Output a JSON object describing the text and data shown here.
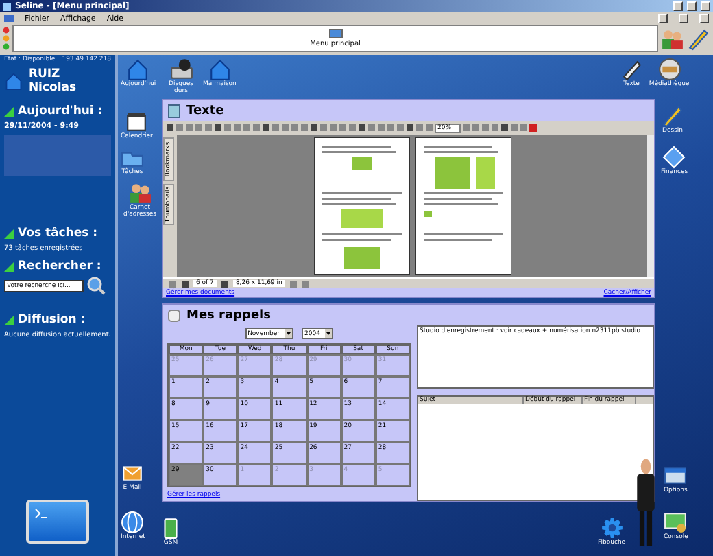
{
  "window": {
    "title": "Seline - [Menu principal]"
  },
  "menu": [
    "Fichier",
    "Affichage",
    "Aide"
  ],
  "toolbar": {
    "center_label": "Menu principal"
  },
  "sidebar": {
    "status": "Etat : Disponible",
    "address": "193.49.142.218",
    "user": "RUIZ Nicolas",
    "sections": [
      {
        "kind": "today",
        "title": "Aujourd'hui :",
        "text": "29/11/2004 - 9:49"
      },
      {
        "kind": "text",
        "title": "Vos tâches :",
        "text": "73 tâches enregistrées"
      },
      {
        "kind": "search",
        "title": "Rechercher :",
        "value": "Votre recherche ici..."
      },
      {
        "kind": "text",
        "title": "Diffusion :",
        "text": "Aucune diffusion actuellement."
      }
    ]
  },
  "desktop_icons": [
    "Aujourd'hui",
    "Disques durs",
    "Ma maison",
    "Calendrier",
    "Tâches",
    "Carnet d'adresses",
    "Texte",
    "Médiathèque",
    "Dessin",
    "Finances",
    "E-Mail",
    "Internet",
    "GSM",
    "Fibouche",
    "Options",
    "Console"
  ],
  "text_window": {
    "title": "Texte",
    "zoom": "20%",
    "side_tabs": [
      "Bookmarks",
      "Thumbnails"
    ],
    "page_indicator": "6 of 7",
    "page_size": "8,26 x 11,69 in",
    "links": [
      "Gérer mes documents",
      "Cacher/Afficher"
    ]
  },
  "reminders": {
    "title": "Mes rappels",
    "month": "November",
    "year": "2004",
    "weekdays": [
      "Mon",
      "Tue",
      "Wed",
      "Thu",
      "Fri",
      "Sat",
      "Sun"
    ],
    "weeks": [
      [
        {
          "day": "25",
          "in_month": false,
          "selected": false
        },
        {
          "day": "26",
          "in_month": false,
          "selected": false
        },
        {
          "day": "27",
          "in_month": false,
          "selected": false
        },
        {
          "day": "28",
          "in_month": false,
          "selected": false
        },
        {
          "day": "29",
          "in_month": false,
          "selected": false
        },
        {
          "day": "30",
          "in_month": false,
          "selected": false
        },
        {
          "day": "31",
          "in_month": false,
          "selected": false
        }
      ],
      [
        {
          "day": "1",
          "in_month": true,
          "selected": false
        },
        {
          "day": "2",
          "in_month": true,
          "selected": false
        },
        {
          "day": "3",
          "in_month": true,
          "selected": false
        },
        {
          "day": "4",
          "in_month": true,
          "selected": false
        },
        {
          "day": "5",
          "in_month": true,
          "selected": false
        },
        {
          "day": "6",
          "in_month": true,
          "selected": false
        },
        {
          "day": "7",
          "in_month": true,
          "selected": false
        }
      ],
      [
        {
          "day": "8",
          "in_month": true,
          "selected": false
        },
        {
          "day": "9",
          "in_month": true,
          "selected": false
        },
        {
          "day": "10",
          "in_month": true,
          "selected": false
        },
        {
          "day": "11",
          "in_month": true,
          "selected": false
        },
        {
          "day": "12",
          "in_month": true,
          "selected": false
        },
        {
          "day": "13",
          "in_month": true,
          "selected": false
        },
        {
          "day": "14",
          "in_month": true,
          "selected": false
        }
      ],
      [
        {
          "day": "15",
          "in_month": true,
          "selected": false
        },
        {
          "day": "16",
          "in_month": true,
          "selected": false
        },
        {
          "day": "17",
          "in_month": true,
          "selected": false
        },
        {
          "day": "18",
          "in_month": true,
          "selected": false
        },
        {
          "day": "19",
          "in_month": true,
          "selected": false
        },
        {
          "day": "20",
          "in_month": true,
          "selected": false
        },
        {
          "day": "21",
          "in_month": true,
          "selected": false
        }
      ],
      [
        {
          "day": "22",
          "in_month": true,
          "selected": false
        },
        {
          "day": "23",
          "in_month": true,
          "selected": false
        },
        {
          "day": "24",
          "in_month": true,
          "selected": false
        },
        {
          "day": "25",
          "in_month": true,
          "selected": false
        },
        {
          "day": "26",
          "in_month": true,
          "selected": false
        },
        {
          "day": "27",
          "in_month": true,
          "selected": false
        },
        {
          "day": "28",
          "in_month": true,
          "selected": false
        }
      ],
      [
        {
          "day": "29",
          "in_month": true,
          "selected": true
        },
        {
          "day": "30",
          "in_month": true,
          "selected": false
        },
        {
          "day": "1",
          "in_month": false,
          "selected": false
        },
        {
          "day": "2",
          "in_month": false,
          "selected": false
        },
        {
          "day": "3",
          "in_month": false,
          "selected": false
        },
        {
          "day": "4",
          "in_month": false,
          "selected": false
        },
        {
          "day": "5",
          "in_month": false,
          "selected": false
        }
      ]
    ],
    "note": "Studio d'enregistrement : voir cadeaux + numérisation n2311pb studio",
    "columns": [
      "Sujet",
      "Début du rappel",
      "Fin du rappel"
    ],
    "link": "Gérer les rappels"
  }
}
